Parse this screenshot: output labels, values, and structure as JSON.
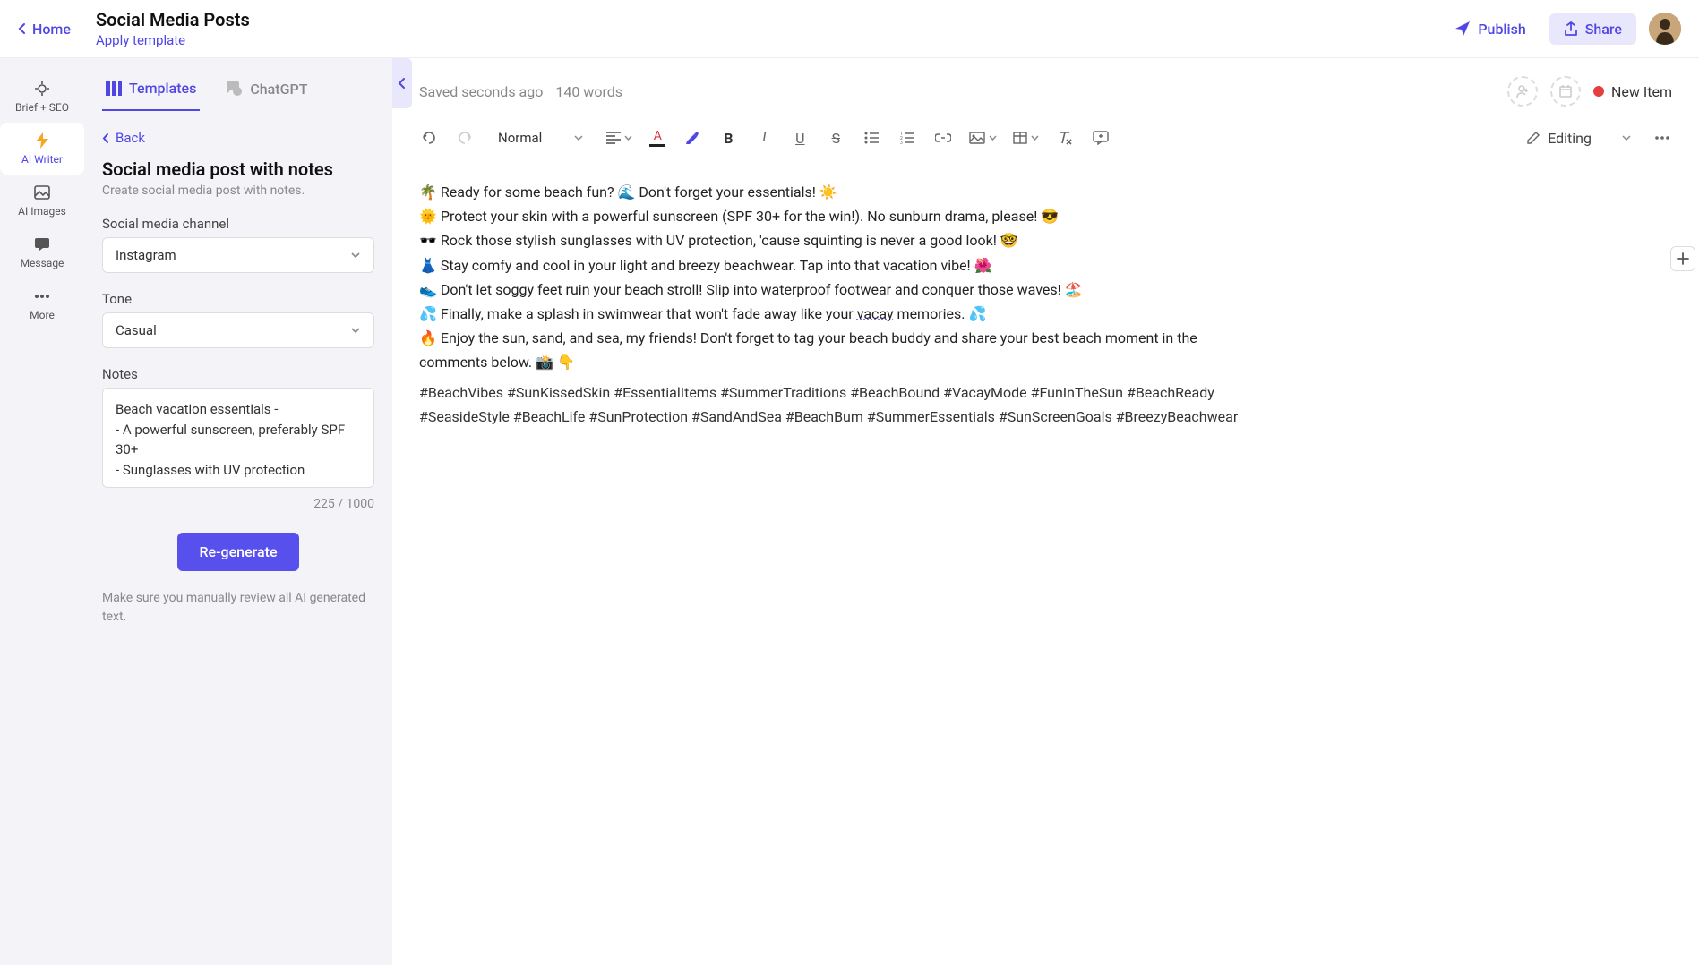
{
  "header": {
    "home": "Home",
    "title": "Social Media Posts",
    "apply_template": "Apply template",
    "publish": "Publish",
    "share": "Share"
  },
  "nav": {
    "items": [
      {
        "label": "Brief + SEO"
      },
      {
        "label": "AI Writer"
      },
      {
        "label": "AI Images"
      },
      {
        "label": "Message"
      },
      {
        "label": "More"
      }
    ]
  },
  "panel": {
    "tabs": [
      {
        "label": "Templates"
      },
      {
        "label": "ChatGPT"
      }
    ],
    "back": "Back",
    "title": "Social media post with notes",
    "subtitle": "Create social media post with notes.",
    "channel_label": "Social media channel",
    "channel_value": "Instagram",
    "tone_label": "Tone",
    "tone_value": "Casual",
    "notes_label": "Notes",
    "notes_value": "Beach vacation essentials -\n- A powerful sunscreen, preferably SPF 30+\n- Sunglasses with UV protection",
    "char_count": "225 / 1000",
    "regenerate": "Re-generate",
    "review": "Make sure you manually review all AI generated text."
  },
  "editor": {
    "saved": "Saved seconds ago",
    "words": "140 words",
    "new_item": "New Item",
    "format": "Normal",
    "editing_mode": "Editing",
    "content": [
      "🌴 Ready for some beach fun? 🌊 Don't forget your essentials! ☀️",
      "🌞 Protect your skin with a powerful sunscreen (SPF 30+ for the win!). No sunburn drama, please! 😎",
      "🕶️ Rock those stylish sunglasses with UV protection, 'cause squinting is never a good look! 🤓",
      "👗 Stay comfy and cool in your light and breezy beachwear. Tap into that vacation vibe! 🌺",
      "👟 Don't let soggy feet ruin your beach stroll! Slip into waterproof footwear and conquer those waves! 🏖️",
      "💦 Finally, make a splash in swimwear that won't fade away like your vacay memories. 💦",
      "🔥 Enjoy the sun, sand, and sea, my friends! Don't forget to tag your beach buddy and share your best beach moment in the comments below. 📸 👇"
    ],
    "hashtags": "#BeachVibes #SunKissedSkin #EssentialItems #SummerTraditions #BeachBound #VacayMode #FunInTheSun #BeachReady #SeasideStyle #BeachLife #SunProtection #SandAndSea #BeachBum #SummerEssentials #SunScreenGoals #BreezyBeachwear"
  }
}
